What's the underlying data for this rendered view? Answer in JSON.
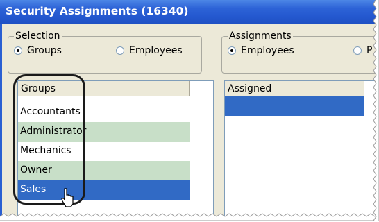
{
  "window": {
    "title": "Security Assignments (16340)"
  },
  "selection": {
    "legend": "Selection",
    "options": [
      {
        "label": "Groups",
        "checked": true
      },
      {
        "label": "Employees",
        "checked": false
      }
    ]
  },
  "assignments": {
    "legend": "Assignments",
    "options": [
      {
        "label": "Employees",
        "checked": true
      },
      {
        "label": "P",
        "checked": false
      }
    ]
  },
  "groups_list": {
    "header": "Groups",
    "rows": [
      {
        "label": "Accountants",
        "state": "normal"
      },
      {
        "label": "Administrator",
        "state": "alt"
      },
      {
        "label": "Mechanics",
        "state": "normal"
      },
      {
        "label": "Owner",
        "state": "alt"
      },
      {
        "label": "Sales",
        "state": "selected"
      }
    ]
  },
  "assigned_list": {
    "header": "Assigned",
    "rows": [
      {
        "label": "",
        "state": "selected"
      }
    ]
  },
  "colors": {
    "title_bar": "#2458cf",
    "selected_row": "#316ac5",
    "alt_row": "#c8dfc8",
    "window_bg": "#ece9d8"
  }
}
